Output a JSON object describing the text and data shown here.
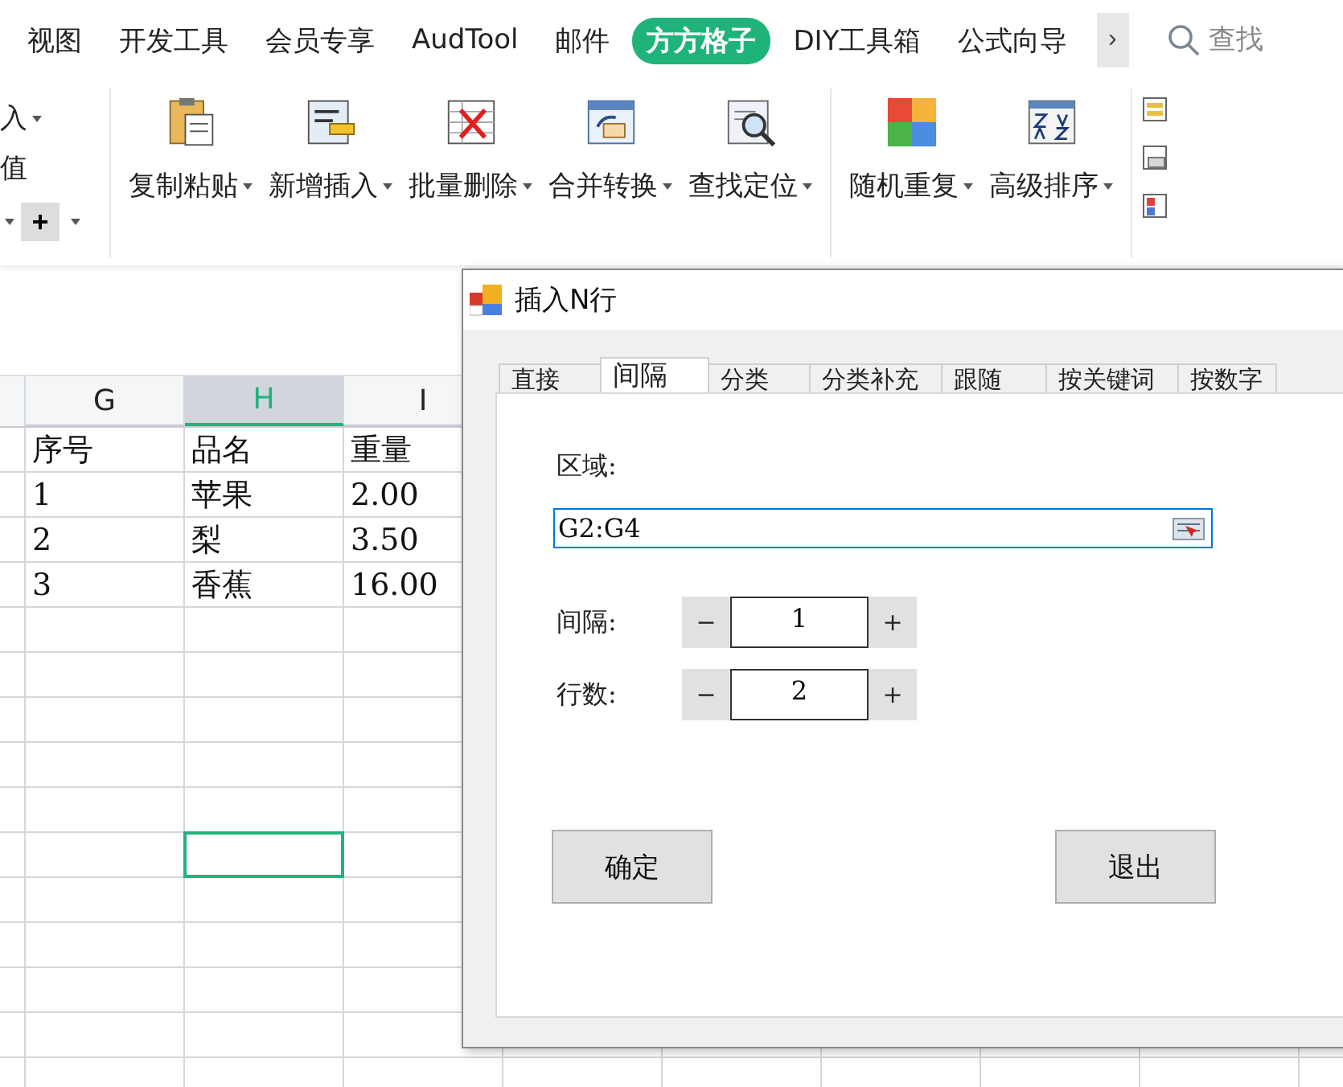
{
  "ribbon_tabs": [
    {
      "label": "视图",
      "selected": false
    },
    {
      "label": "开发工具",
      "selected": false
    },
    {
      "label": "会员专享",
      "selected": false
    },
    {
      "label": "AudTool",
      "selected": false
    },
    {
      "label": "邮件",
      "selected": false
    },
    {
      "label": "方方格子",
      "selected": true
    },
    {
      "label": "DIY工具箱",
      "selected": false
    },
    {
      "label": "公式向导",
      "selected": false
    }
  ],
  "more_tabs_button": "›",
  "search": {
    "placeholder": "查找"
  },
  "left_group": {
    "top": "入",
    "middle": "值",
    "plus": "+"
  },
  "tools": [
    {
      "label": "复制粘贴",
      "kind": "paste"
    },
    {
      "label": "新增插入",
      "kind": "insert"
    },
    {
      "label": "批量删除",
      "kind": "delete"
    },
    {
      "label": "合并转换",
      "kind": "merge"
    },
    {
      "label": "查找定位",
      "kind": "find"
    },
    {
      "label": "随机重复",
      "kind": "random"
    },
    {
      "label": "高级排序",
      "kind": "sort"
    }
  ],
  "sheet": {
    "columns": [
      {
        "label": "G",
        "selected": false
      },
      {
        "label": "H",
        "selected": true
      },
      {
        "label": "I",
        "selected": false
      }
    ],
    "rows": [
      [
        "序号",
        "品名",
        "重量"
      ],
      [
        "1",
        "苹果",
        "2.00"
      ],
      [
        "2",
        "梨",
        "3.50"
      ],
      [
        "3",
        "香蕉",
        "16.00"
      ]
    ]
  },
  "dialog": {
    "title": "插入N行",
    "tabs": [
      {
        "label": "直接",
        "selected": false
      },
      {
        "label": "间隔",
        "selected": true
      },
      {
        "label": "分类",
        "selected": false
      },
      {
        "label": "分类补充",
        "selected": false
      },
      {
        "label": "跟随",
        "selected": false
      },
      {
        "label": "按关键词",
        "selected": false
      },
      {
        "label": "按数字",
        "selected": false
      }
    ],
    "region_label": "区域:",
    "region_value": "G2:G4",
    "spinners": [
      {
        "label": "间隔:",
        "value": "1",
        "minus": "−",
        "plus": "+"
      },
      {
        "label": "行数:",
        "value": "2",
        "minus": "−",
        "plus": "+"
      }
    ],
    "buttons": [
      "确定",
      "退出"
    ]
  }
}
